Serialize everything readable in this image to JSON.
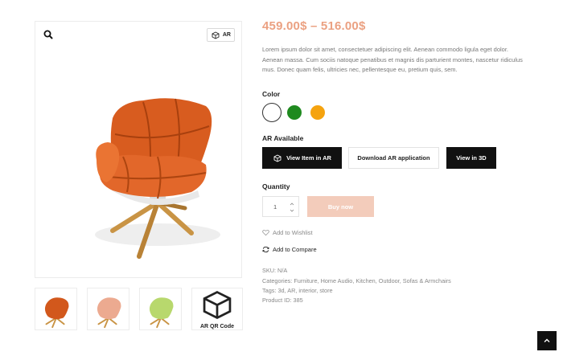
{
  "gallery": {
    "ar_badge_label": "AR",
    "qr_label": "AR QR Code",
    "thumb_colors": [
      "#d2581c",
      "#ecaa90",
      "#b8d86d"
    ]
  },
  "product": {
    "price": "459.00$ – 516.00$",
    "description": "Lorem ipsum dolor sit amet, consectetuer adipiscing elit. Aenean commodo ligula eget dolor. Aenean massa. Cum sociis natoque penatibus et magnis dis parturient montes, nascetur ridiculus mus. Donec quam felis, ultricies nec, pellentesque eu, pretium quis, sem.",
    "color_label": "Color",
    "colors": [
      "#ffffff",
      "#1f8a1f",
      "#f5a30f"
    ],
    "ar_available_label": "AR Available",
    "buttons": {
      "view_in_ar": "View Item in AR",
      "download_ar": "Download AR application",
      "view_3d": "View in 3D"
    },
    "quantity_label": "Quantity",
    "quantity_value": "1",
    "buy_now": "Buy now",
    "wishlist": "Add to Wishlist",
    "compare": "Add to Compare",
    "sku": "SKU: N/A",
    "categories": "Categories: Furniture, Home Audio, Kitchen, Outdoor, Sofas & Armchairs",
    "tags": "Tags: 3d, AR, interior, store",
    "product_id": "Product ID: 385"
  },
  "colors": {
    "accent_price": "#eba182",
    "buy_button": "#f3ccbb",
    "dark_button": "#111111"
  }
}
